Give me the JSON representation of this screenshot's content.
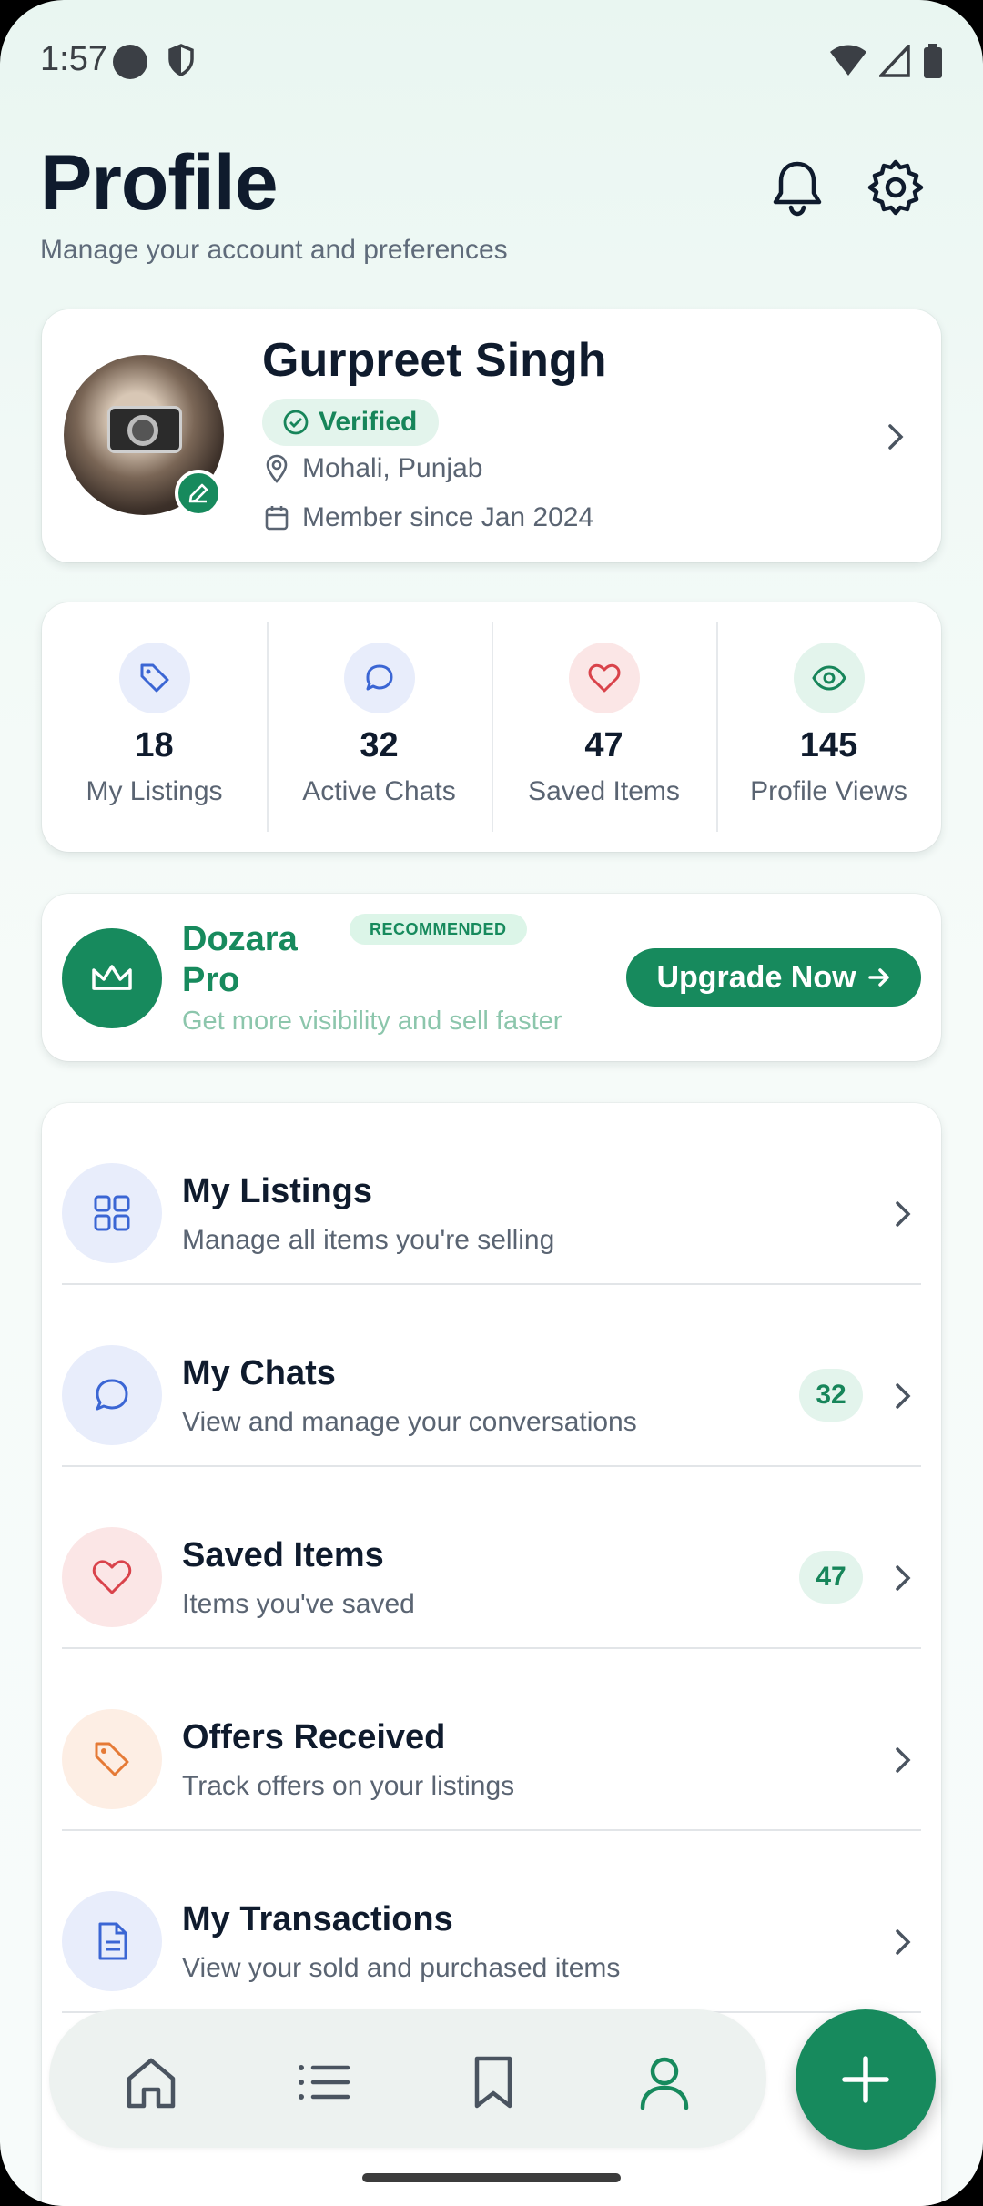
{
  "status_bar": {
    "time": "1:57"
  },
  "header": {
    "title": "Profile",
    "subtitle": "Manage your account and preferences"
  },
  "profile": {
    "name": "Gurpreet Singh",
    "verified_label": "Verified",
    "location": "Mohali, Punjab",
    "member_since": "Member since Jan 2024"
  },
  "stats": [
    {
      "value": "18",
      "label": "My Listings",
      "icon": "tag-icon"
    },
    {
      "value": "32",
      "label": "Active Chats",
      "icon": "chat-icon"
    },
    {
      "value": "47",
      "label": "Saved Items",
      "icon": "heart-icon"
    },
    {
      "value": "145",
      "label": "Profile Views",
      "icon": "eye-icon"
    }
  ],
  "pro": {
    "title": "Dozara Pro",
    "badge": "RECOMMENDED",
    "subtitle": "Get more visibility and sell faster",
    "cta": "Upgrade Now"
  },
  "menu": [
    {
      "title": "My Listings",
      "subtitle": "Manage all items you're selling",
      "icon": "grid-icon"
    },
    {
      "title": "My Chats",
      "subtitle": "View and manage your conversations",
      "badge": "32",
      "icon": "chat-icon"
    },
    {
      "title": "Saved Items",
      "subtitle": "Items you've saved",
      "badge": "47",
      "icon": "heart-icon"
    },
    {
      "title": "Offers Received",
      "subtitle": "Track offers on your listings",
      "icon": "tag-icon"
    },
    {
      "title": "My Transactions",
      "subtitle": "View your sold and purchased items",
      "icon": "document-icon"
    }
  ],
  "nav": [
    "home-icon",
    "list-icon",
    "bookmark-icon",
    "person-icon"
  ],
  "colors": {
    "accent": "#178a5d",
    "text_primary": "#0f1b2d",
    "text_secondary": "#5a6472"
  }
}
